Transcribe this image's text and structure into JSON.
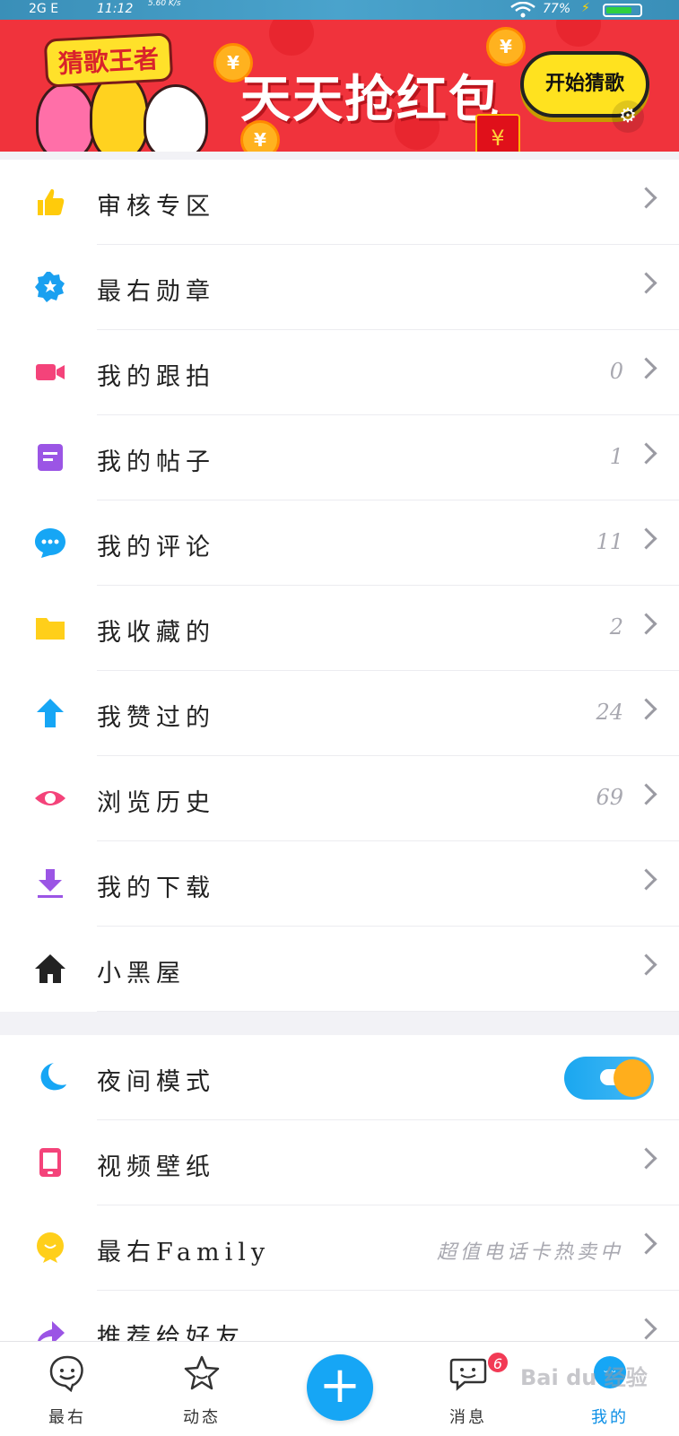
{
  "status_bar": {
    "network": "2G E",
    "time": "11:12",
    "speed": "5.60 K/s",
    "battery_pct": "77%",
    "battery_level": 0.77
  },
  "banner": {
    "game_title": "猜歌王者",
    "headline": "天天抢红包",
    "cta": "开始猜歌",
    "coin_symbol": "¥"
  },
  "menu": [
    {
      "label": "审核专区",
      "count": "",
      "icon": "thumbs-up-icon",
      "color": "#ffcb0b"
    },
    {
      "label": "最右勋章",
      "count": "",
      "icon": "badge-star-icon",
      "color": "#1aa0f0"
    },
    {
      "label": "我的跟拍",
      "count": "0",
      "icon": "video-camera-icon",
      "color": "#f4437a"
    },
    {
      "label": "我的帖子",
      "count": "1",
      "icon": "post-document-icon",
      "color": "#9b55e5"
    },
    {
      "label": "我的评论",
      "count": "11",
      "icon": "comment-bubble-icon",
      "color": "#16a6f5"
    },
    {
      "label": "我收藏的",
      "count": "2",
      "icon": "folder-icon",
      "color": "#ffcf1a"
    },
    {
      "label": "我赞过的",
      "count": "24",
      "icon": "up-arrow-icon",
      "color": "#16a6f5"
    },
    {
      "label": "浏览历史",
      "count": "69",
      "icon": "eye-icon",
      "color": "#f4437a"
    },
    {
      "label": "我的下载",
      "count": "",
      "icon": "download-icon",
      "color": "#9b55e5"
    },
    {
      "label": "小黑屋",
      "count": "",
      "icon": "house-icon",
      "color": "#222222"
    }
  ],
  "settings": [
    {
      "label": "夜间模式",
      "type": "toggle",
      "icon": "moon-icon",
      "color": "#16a6f5"
    },
    {
      "label": "视频壁纸",
      "type": "link",
      "icon": "phone-wallpaper-icon",
      "color": "#f4437a"
    },
    {
      "label": "最右Family",
      "type": "link",
      "promo": "超值电话卡热卖中",
      "icon": "family-mascot-icon",
      "color": "#ffcf1a"
    },
    {
      "label": "推荐给好友",
      "type": "link",
      "icon": "share-icon",
      "color": "#9b55e5"
    }
  ],
  "tabbar": {
    "tabs": [
      {
        "label": "最右"
      },
      {
        "label": "动态"
      },
      {
        "label": "消息",
        "badge": "6"
      },
      {
        "label": "我的"
      }
    ],
    "fab": "+",
    "watermark": "Bai du 经验"
  }
}
